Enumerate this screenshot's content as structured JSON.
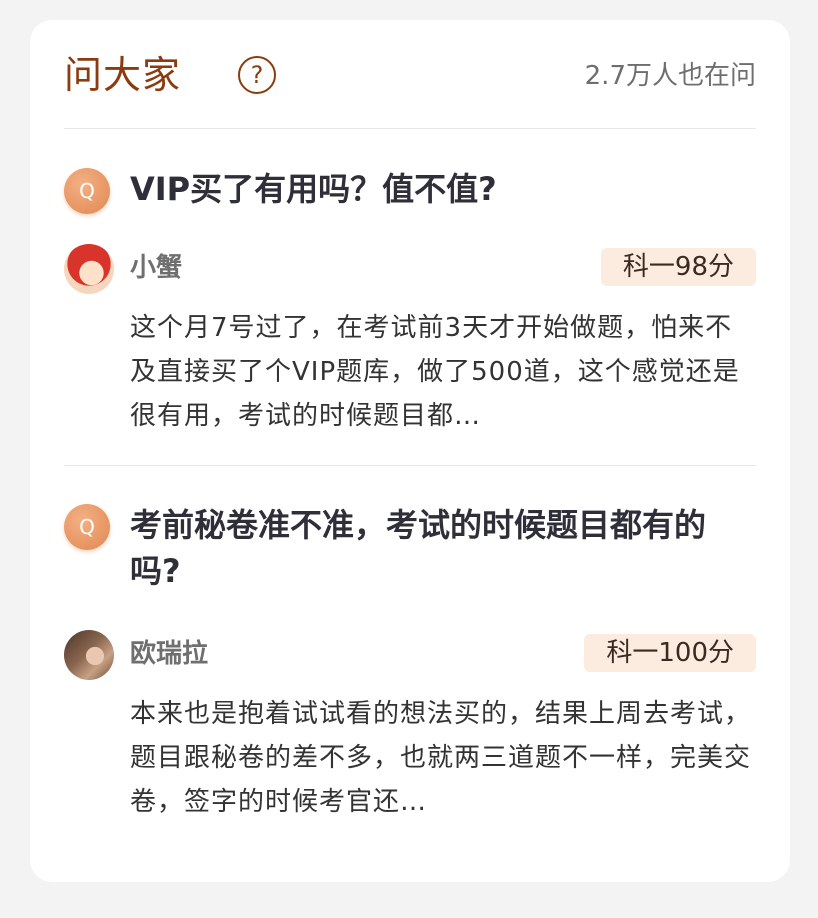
{
  "header": {
    "title": "问大家",
    "help_symbol": "?",
    "asking_count": "2.7万人也在问"
  },
  "questions": [
    {
      "icon_label": "Q",
      "text": "VIP买了有用吗？值不值?",
      "answer": {
        "user": "小蟹",
        "score": "科一98分",
        "text": "这个月7号过了，在考试前3天才开始做题，怕来不及直接买了个VIP题库，做了500道，这个感觉还是很有用，考试的时候题目都…"
      }
    },
    {
      "icon_label": "Q",
      "text": "考前秘卷准不准，考试的时候题目都有的吗?",
      "answer": {
        "user": "欧瑞拉",
        "score": "科一100分",
        "text": "本来也是抱着试试看的想法买的，结果上周去考试，题目跟秘卷的差不多，也就两三道题不一样，完美交卷，签字的时候考官还…"
      }
    }
  ],
  "colors": {
    "title": "#8a3b10",
    "q_icon": "#e2874f",
    "score_bg": "#fcebdf"
  }
}
